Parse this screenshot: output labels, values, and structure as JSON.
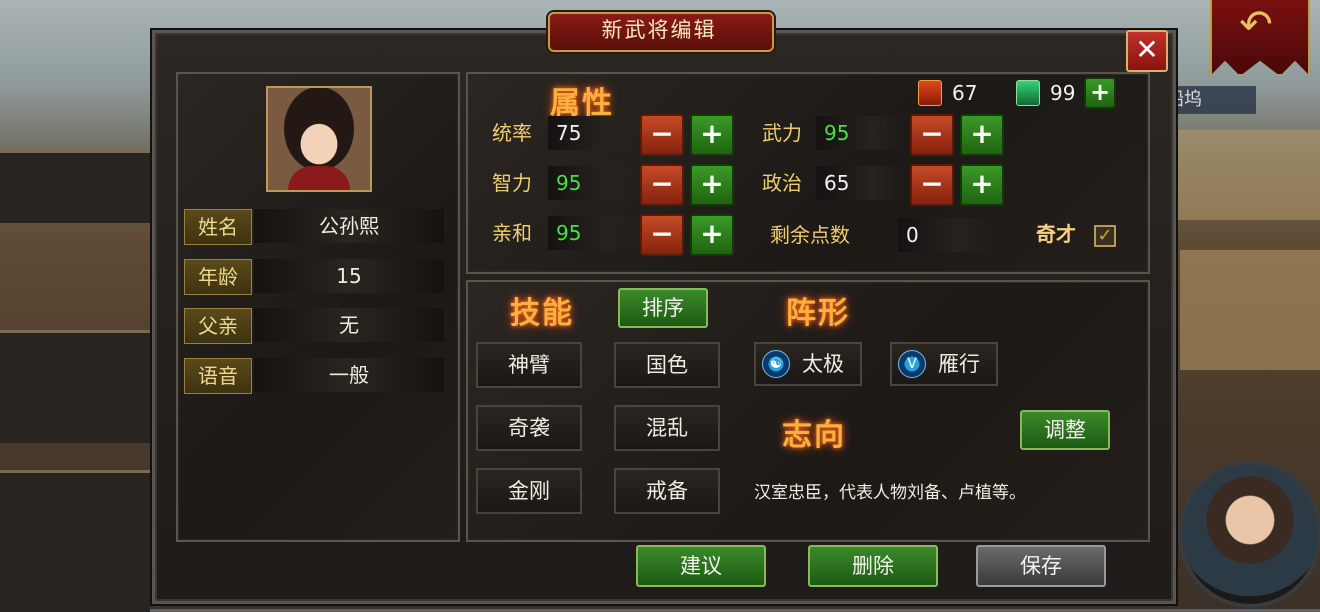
{
  "dialog": {
    "title": "新武将编辑",
    "close_label": "✕"
  },
  "background": {
    "map_label": "船坞"
  },
  "profile": {
    "rows": [
      {
        "label": "姓名",
        "value": "公孙熙"
      },
      {
        "label": "年龄",
        "value": "15"
      },
      {
        "label": "父亲",
        "value": "无"
      },
      {
        "label": "语音",
        "value": "一般"
      }
    ]
  },
  "attributes": {
    "heading": "属性",
    "resources": [
      {
        "icon": "scroll-token-icon",
        "value": "67"
      },
      {
        "icon": "jade-token-icon",
        "value": "99"
      }
    ],
    "add_label": "+",
    "minus_label": "−",
    "plus_label": "+",
    "stats": [
      {
        "label": "统率",
        "value": "75",
        "color": "#f2f2ee"
      },
      {
        "label": "武力",
        "value": "95",
        "color": "#48e048"
      },
      {
        "label": "智力",
        "value": "95",
        "color": "#48e048"
      },
      {
        "label": "政治",
        "value": "65",
        "color": "#f2f2ee"
      },
      {
        "label": "亲和",
        "value": "95",
        "color": "#48e048"
      }
    ],
    "remaining_label": "剩余点数",
    "remaining_value": "0",
    "genius_label": "奇才",
    "genius_checked": true,
    "check_mark": "✓"
  },
  "skills": {
    "heading": "技能",
    "sort_label": "排序",
    "items": [
      "神臂",
      "国色",
      "奇袭",
      "混乱",
      "金刚",
      "戒备"
    ]
  },
  "formation": {
    "heading": "阵形",
    "items": [
      {
        "label": "太极",
        "icon_glyph": "☯"
      },
      {
        "label": "雁行",
        "icon_glyph": "V"
      }
    ]
  },
  "ambition": {
    "heading": "志向",
    "adjust_label": "调整",
    "description": "汉室忠臣，代表人物刘备、卢植等。"
  },
  "footer": {
    "suggest_label": "建议",
    "delete_label": "删除",
    "save_label": "保存"
  },
  "colors": {
    "accent_orange": "#f8b040",
    "green_value": "#48e048",
    "title_red": "#8a1a14"
  }
}
